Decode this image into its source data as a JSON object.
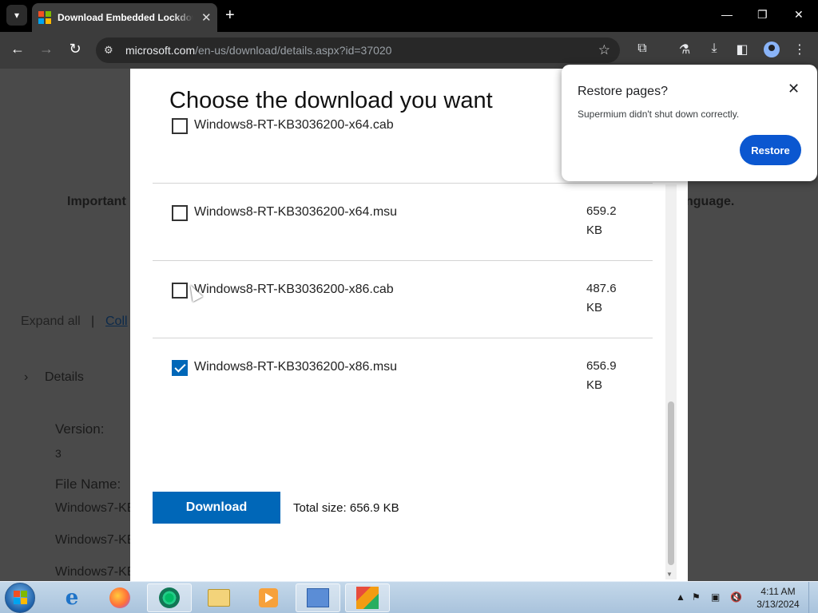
{
  "browser": {
    "tab_title": "Download Embedded Lockdown Manager",
    "url_domain": "microsoft.com",
    "url_path": "/en-us/download/details.aspx?id=37020"
  },
  "background_page": {
    "important_text": "Important",
    "language_text": "nguage.",
    "expand_all": "Expand all",
    "separator": "|",
    "collapse": "Coll",
    "details_label": "Details",
    "version_label": "Version:",
    "version_value": "3",
    "file_name_label": "File Name:",
    "file_rows": [
      "Windows7-KE",
      "Windows7-KE",
      "Windows7-KE"
    ]
  },
  "modal": {
    "title": "Choose the download you want",
    "files": [
      {
        "name": "Windows8-RT-KB3036200-x64.cab",
        "size_value": "",
        "size_unit": "",
        "checked": false
      },
      {
        "name": "Windows8-RT-KB3036200-x64.msu",
        "size_value": "659.2",
        "size_unit": "KB",
        "checked": false
      },
      {
        "name": "Windows8-RT-KB3036200-x86.cab",
        "size_value": "487.6",
        "size_unit": "KB",
        "checked": false
      },
      {
        "name": "Windows8-RT-KB3036200-x86.msu",
        "size_value": "656.9",
        "size_unit": "KB",
        "checked": true
      }
    ],
    "download_label": "Download",
    "total_size": "Total size: 656.9 KB"
  },
  "restore_popup": {
    "title": "Restore pages?",
    "message": "Supermium didn't shut down correctly.",
    "restore_label": "Restore"
  },
  "taskbar": {
    "time": "4:11 AM",
    "date": "3/13/2024"
  },
  "colors": {
    "accent": "#0067b8",
    "restore_button": "#0b57d0"
  }
}
